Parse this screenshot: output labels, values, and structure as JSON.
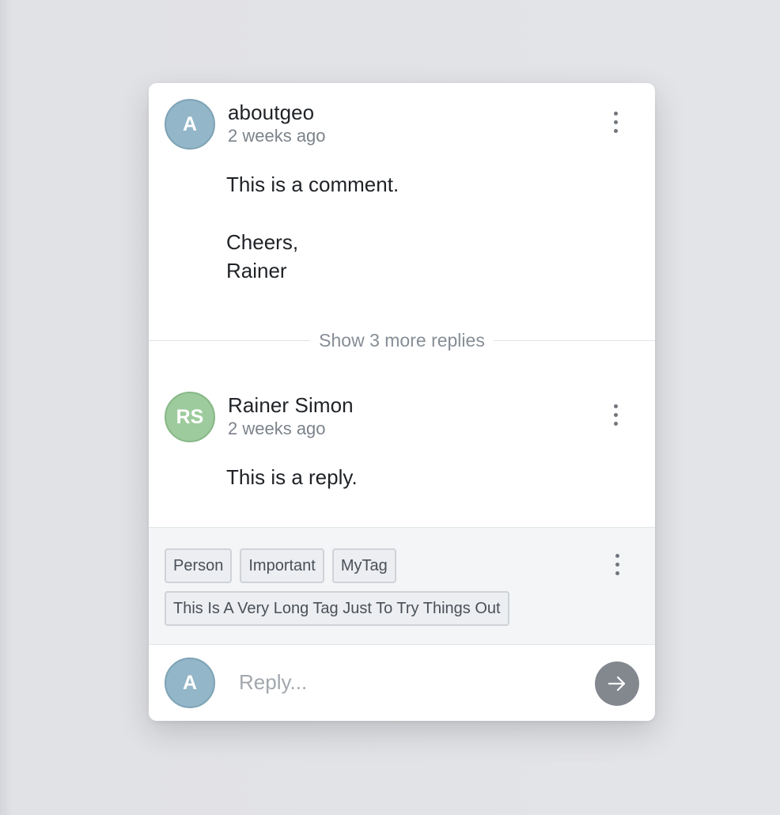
{
  "colors": {
    "avatar_blue": "#93b6c8",
    "avatar_green": "#9ecb9d",
    "send_button": "#83888f",
    "tags_background": "#f4f5f7"
  },
  "comments": [
    {
      "avatar_initials": "A",
      "author": "aboutgeo",
      "timestamp": "2 weeks ago",
      "body": [
        "This is a comment.",
        "Cheers,",
        "Rainer"
      ],
      "menu_icon": "kebab-menu-icon"
    },
    {
      "avatar_initials": "RS",
      "author": "Rainer Simon",
      "timestamp": "2 weeks ago",
      "body": [
        "This is a reply."
      ],
      "menu_icon": "kebab-menu-icon"
    }
  ],
  "show_more_replies": "Show 3 more replies",
  "tags": [
    "Person",
    "Important",
    "MyTag",
    "This Is A Very Long Tag Just To Try Things Out"
  ],
  "reply": {
    "avatar_initials": "A",
    "placeholder": "Reply...",
    "value": "",
    "send_icon": "arrow-right-icon"
  }
}
